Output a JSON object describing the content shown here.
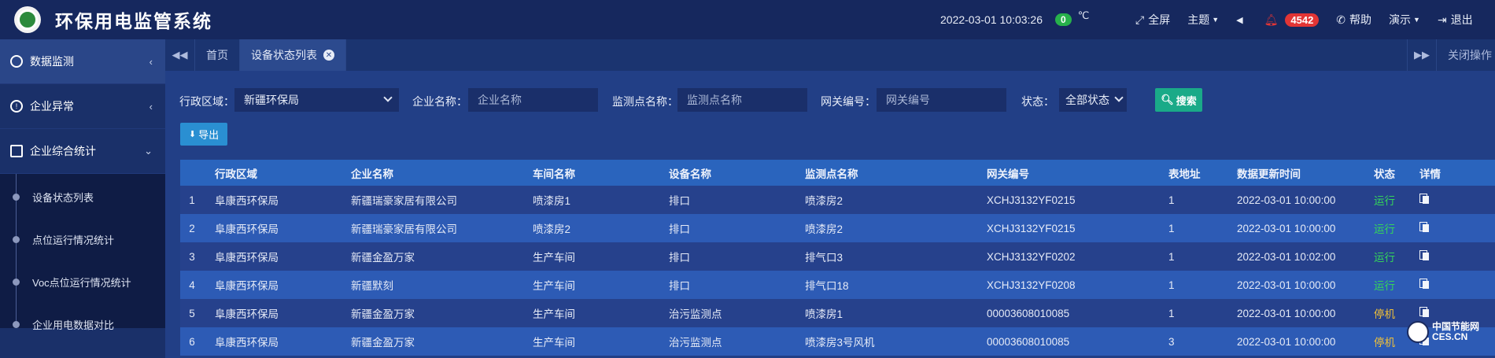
{
  "header": {
    "title": "环保用电监管系统",
    "datetime": "2022-03-01  10:03:26",
    "temperature": "0",
    "temperature_unit": "℃",
    "actions": {
      "fullscreen": "全屏",
      "theme": "主题",
      "alarm_count": "4542",
      "help": "帮助",
      "demo": "演示",
      "logout": "退出"
    }
  },
  "sidebar": {
    "items": [
      {
        "label": "数据监测"
      },
      {
        "label": "企业异常"
      },
      {
        "label": "企业综合统计"
      }
    ],
    "subitems": [
      {
        "label": "设备状态列表"
      },
      {
        "label": "点位运行情况统计"
      },
      {
        "label": "Voc点位运行情况统计"
      },
      {
        "label": "企业用电数据对比"
      }
    ]
  },
  "tabs": {
    "home": "首页",
    "active": "设备状态列表",
    "close_ops": "关闭操作"
  },
  "filters": {
    "region_label": "行政区域：",
    "region_value": "新疆环保局",
    "company_label": "企业名称：",
    "company_placeholder": "企业名称",
    "point_label": "监测点名称：",
    "point_placeholder": "监测点名称",
    "gateway_label": "网关编号：",
    "gateway_placeholder": "网关编号",
    "status_label": "状态：",
    "status_value": "全部状态",
    "search_label": "搜索",
    "export_label": "导出"
  },
  "table": {
    "headers": [
      "",
      "行政区域",
      "企业名称",
      "车间名称",
      "设备名称",
      "监测点名称",
      "网关编号",
      "表地址",
      "数据更新时间",
      "状态",
      "详情"
    ],
    "rows": [
      {
        "no": "1",
        "region": "阜康西环保局",
        "company": "新疆瑞豪家居有限公司",
        "workshop": " 喷漆房1",
        "device": "排口",
        "point": "喷漆房2",
        "gateway": "XCHJ3132YF0215",
        "addr": "1",
        "time": "2022-03-01 10:00:00",
        "status": "运行"
      },
      {
        "no": "2",
        "region": "阜康西环保局",
        "company": "新疆瑞豪家居有限公司",
        "workshop": "喷漆房2",
        "device": "排口",
        "point": "喷漆房2",
        "gateway": "XCHJ3132YF0215",
        "addr": "1",
        "time": "2022-03-01 10:00:00",
        "status": "运行"
      },
      {
        "no": "3",
        "region": "阜康西环保局",
        "company": "新疆金盈万家",
        "workshop": "生产车间",
        "device": "排口",
        "point": "排气口3",
        "gateway": "XCHJ3132YF0202",
        "addr": "1",
        "time": "2022-03-01 10:02:00",
        "status": "运行"
      },
      {
        "no": "4",
        "region": "阜康西环保局",
        "company": "新疆默刻",
        "workshop": "生产车间",
        "device": "排口",
        "point": "排气口18",
        "gateway": "XCHJ3132YF0208",
        "addr": "1",
        "time": "2022-03-01 10:00:00",
        "status": "运行"
      },
      {
        "no": "5",
        "region": "阜康西环保局",
        "company": "新疆金盈万家",
        "workshop": "生产车间",
        "device": "治污监测点",
        "point": "喷漆房1",
        "gateway": "00003608010085",
        "addr": "1",
        "time": "2022-03-01 10:00:00",
        "status": "停机"
      },
      {
        "no": "6",
        "region": "阜康西环保局",
        "company": "新疆金盈万家",
        "workshop": "生产车间",
        "device": "治污监测点",
        "point": "喷漆房3号风机",
        "gateway": "00003608010085",
        "addr": "3",
        "time": "2022-03-01 10:00:00",
        "status": "停机"
      }
    ]
  },
  "watermark": {
    "line1": "中国节能网",
    "line2": "CES.CN"
  },
  "colors": {
    "run": "#34d35b",
    "stop": "#f0c038",
    "search_button": "#1aaa88",
    "export_button": "#2a8fd2",
    "alarm": "#e23535"
  }
}
